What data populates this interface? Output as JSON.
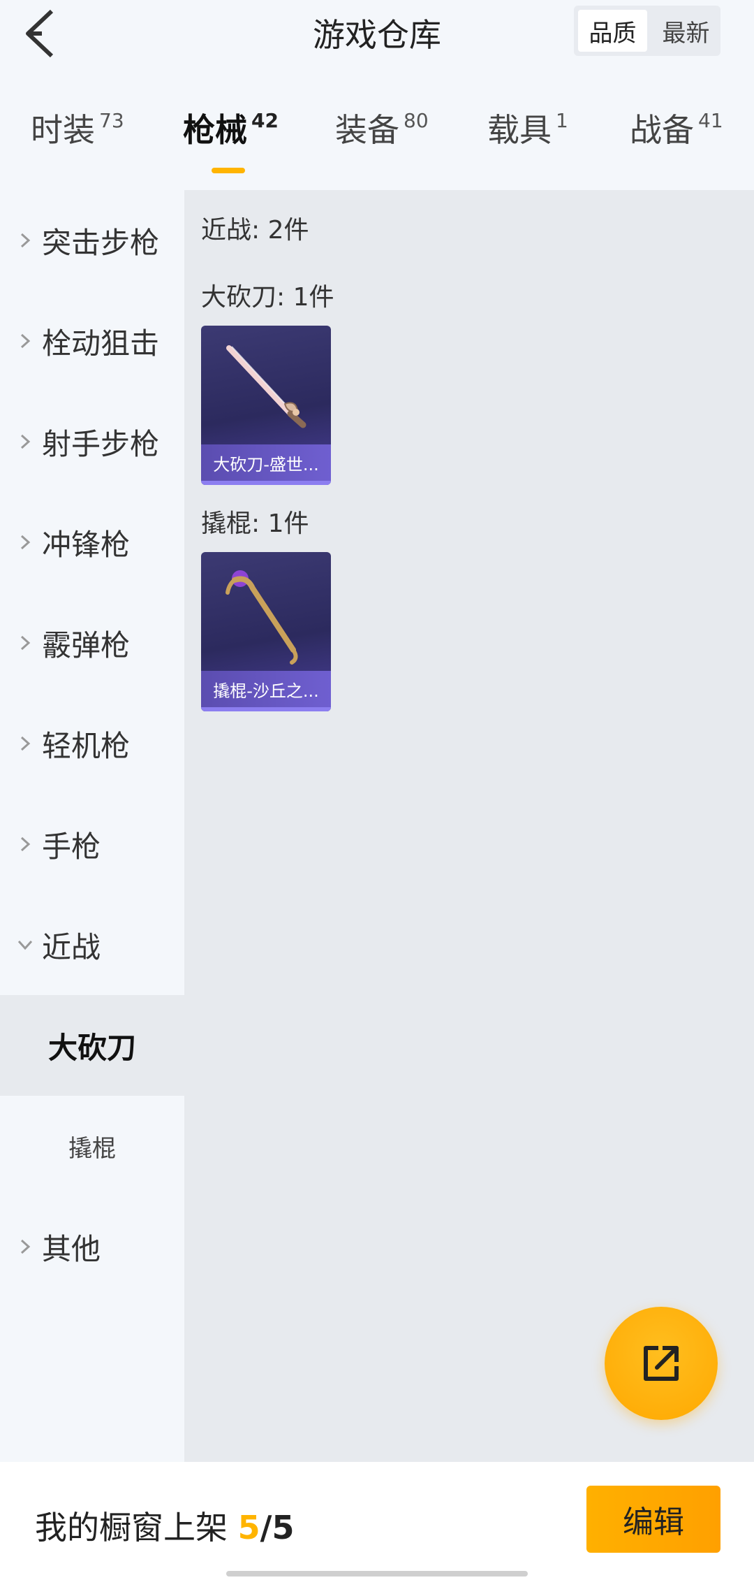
{
  "header": {
    "title": "游戏仓库",
    "sort_options": [
      "品质",
      "最新"
    ],
    "sort_selected": "品质"
  },
  "tabs": [
    {
      "label": "时装",
      "count": "73"
    },
    {
      "label": "枪械",
      "count": "42",
      "active": true
    },
    {
      "label": "装备",
      "count": "80"
    },
    {
      "label": "载具",
      "count": "1"
    },
    {
      "label": "战备",
      "count": "41"
    }
  ],
  "sidebar": {
    "categories": [
      {
        "label": "突击步枪"
      },
      {
        "label": "栓动狙击"
      },
      {
        "label": "射手步枪"
      },
      {
        "label": "冲锋枪"
      },
      {
        "label": "霰弹枪"
      },
      {
        "label": "轻机枪"
      },
      {
        "label": "手枪"
      },
      {
        "label": "近战",
        "expanded": true
      }
    ],
    "sub_items": [
      {
        "label": "大砍刀",
        "selected": true
      },
      {
        "label": "撬棍"
      }
    ],
    "last_category": {
      "label": "其他"
    }
  },
  "content": {
    "section_title": "近战: 2件",
    "groups": [
      {
        "title": "大砍刀: 1件",
        "items": [
          {
            "name": "大砍刀-盛世..."
          }
        ]
      },
      {
        "title": "撬棍: 1件",
        "items": [
          {
            "name": "撬棍-沙丘之..."
          }
        ]
      }
    ]
  },
  "fab": {
    "icon": "share-icon"
  },
  "footer": {
    "label": "我的橱窗上架",
    "count": "5",
    "slash": "/",
    "total": "5",
    "edit_label": "编辑"
  },
  "colors": {
    "accent": "#ffb400",
    "card_bg": "#2c2a5e",
    "caption_bg": "#6f5fd0"
  }
}
